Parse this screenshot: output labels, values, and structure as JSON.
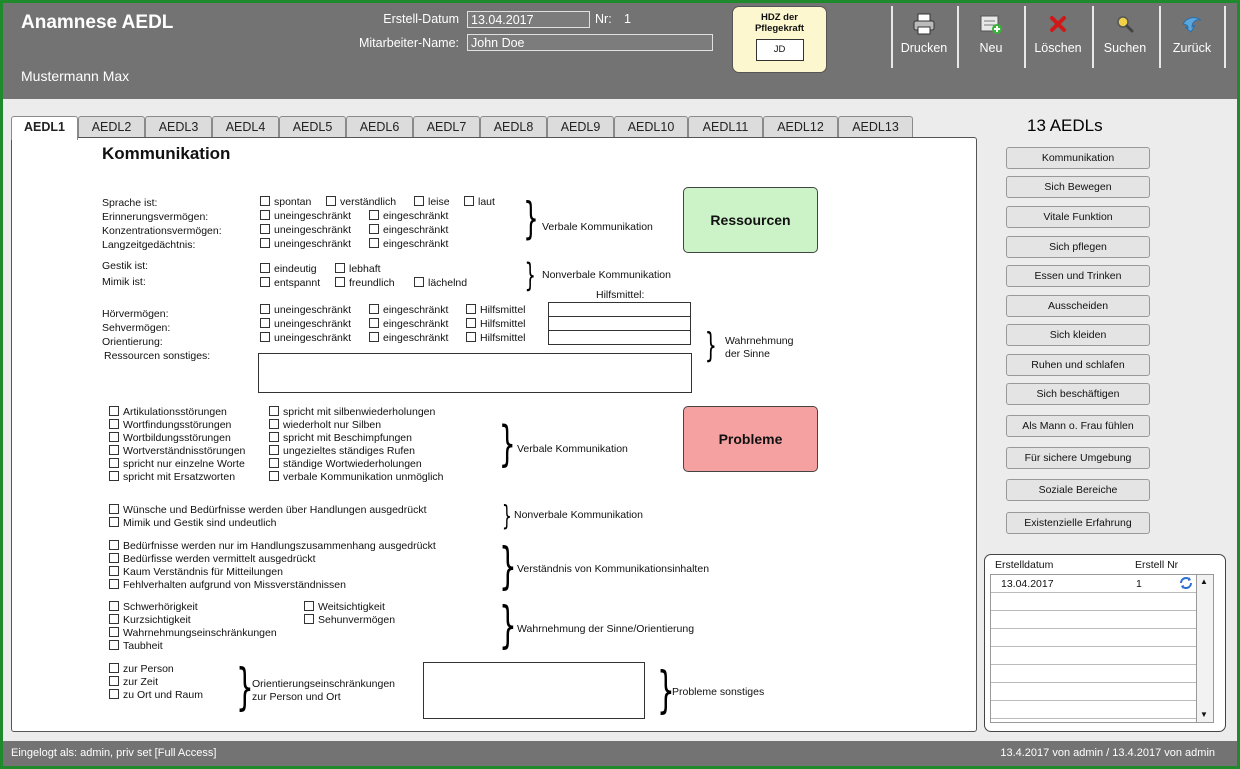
{
  "header": {
    "title": "Anamnese AEDL",
    "patient": "Mustermann Max",
    "created_label": "Erstell-Datum",
    "created_value": "13.04.2017",
    "nr_label": "Nr:",
    "nr_value": "1",
    "employee_label": "Mitarbeiter-Name:",
    "employee_value": "John Doe",
    "hdz_label": "HDZ der Pflegekraft",
    "hdz_value": "JD"
  },
  "toolbar": {
    "print": "Drucken",
    "new": "Neu",
    "delete": "Löschen",
    "search": "Suchen",
    "back": "Zurück"
  },
  "tabs": [
    "AEDL1",
    "AEDL2",
    "AEDL3",
    "AEDL4",
    "AEDL5",
    "AEDL6",
    "AEDL7",
    "AEDL8",
    "AEDL9",
    "AEDL10",
    "AEDL11",
    "AEDL12",
    "AEDL13"
  ],
  "section_title": "Kommunikation",
  "resources": {
    "box_label": "Ressourcen",
    "rows": {
      "sprache": "Sprache ist:",
      "erinnerung": "Erinnerungsvermögen:",
      "konzentration": "Konzentrationsvermögen:",
      "langzeit": "Langzeitgedächtnis:",
      "gestik": "Gestik ist:",
      "mimik": "Mimik ist:",
      "hoer": "Hörvermögen:",
      "seh": "Sehvermögen:",
      "orient": "Orientierung:",
      "sonstiges": "Ressourcen sonstiges:"
    },
    "opts": {
      "spontan": "spontan",
      "verstaendlich": "verständlich",
      "leise": "leise",
      "laut": "laut",
      "uneingeschraenkt": "uneingeschränkt",
      "eingeschraenkt": "eingeschränkt",
      "eindeutig": "eindeutig",
      "lebhaft": "lebhaft",
      "entspannt": "entspannt",
      "freundlich": "freundlich",
      "laechelnd": "lächelnd",
      "hilfsmittel": "Hilfsmittel"
    },
    "hilfsmittel_header": "Hilfsmittel:",
    "group_verbal": "Verbale Kommunikation",
    "group_nonverbal": "Nonverbale Kommunikation",
    "group_sinne_1": "Wahrnehmung",
    "group_sinne_2": "der Sinne"
  },
  "problems": {
    "box_label": "Probleme",
    "verbal_left": [
      "Artikulationsstörungen",
      "Wortfindungsstörungen",
      "Wortbildungsstörungen",
      "Wortverständnisstörungen",
      "spricht nur einzelne Worte",
      "spricht mit Ersatzworten"
    ],
    "verbal_right": [
      "spricht mit silbenwiederholungen",
      "wiederholt nur Silben",
      "spricht mit Beschimpfungen",
      "ungezieltes ständiges Rufen",
      "ständige Wortwiederholungen",
      "verbale Kommunikation unmöglich"
    ],
    "verbal_label": "Verbale Kommunikation",
    "nonverbal": [
      "Wünsche und Bedürfnisse werden über Handlungen ausgedrückt",
      "Mimik und Gestik sind undeutlich"
    ],
    "nonverbal_label": "Nonverbale Kommunikation",
    "verstaendnis": [
      "Bedürfnisse werden nur im Handlungszusammenhang ausgedrückt",
      "Bedürfisse werden vermittelt ausgedrückt",
      "Kaum Verständnis für Mitteilungen",
      "Fehlverhalten aufgrund von Missverständnissen"
    ],
    "verstaendnis_label": "Verständnis von Kommunikationsinhalten",
    "sinne_left": [
      "Schwerhörigkeit",
      "Kurzsichtigkeit",
      "Wahrnehmungseinschränkungen",
      "Taubheit"
    ],
    "sinne_right": [
      "Weitsichtigkeit",
      "Sehunvermögen"
    ],
    "sinne_label": "Wahrnehmung der Sinne/Orientierung",
    "orient": [
      "zur Person",
      "zur Zeit",
      "zu Ort und Raum"
    ],
    "orient_label_1": "Orientierungseinschränkungen",
    "orient_label_2": "zur Person und Ort",
    "sonstiges_label": "Probleme sonstiges"
  },
  "sidebar": {
    "count_label": "13 AEDLs",
    "buttons": [
      "Kommunikation",
      "Sich Bewegen",
      "Vitale Funktion",
      "Sich pflegen",
      "Essen und Trinken",
      "Ausscheiden",
      "Sich kleiden",
      "Ruhen und schlafen",
      "Sich beschäftigen",
      "Als Mann o. Frau fühlen",
      "Für sichere Umgebung",
      "Soziale Bereiche",
      "Existenzielle Erfahrung"
    ]
  },
  "list": {
    "col1": "Erstelldatum",
    "col2": "Erstell Nr",
    "rows": [
      {
        "date": "13.04.2017",
        "nr": "1"
      }
    ]
  },
  "footer": {
    "left": "Eingelogt als: admin, priv set [Full Access]",
    "right": "13.4.2017 von admin / 13.4.2017 von admin"
  }
}
